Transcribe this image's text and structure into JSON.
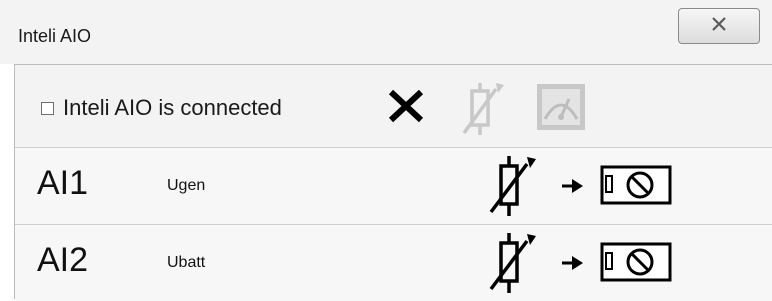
{
  "window": {
    "title": "Inteli AIO"
  },
  "toprow": {
    "checkbox_label": "Inteli AIO is connected",
    "checkbox_checked": false
  },
  "inputs": [
    {
      "name": "AI1",
      "signal": "Ugen"
    },
    {
      "name": "AI2",
      "signal": "Ubatt"
    }
  ],
  "icons": {
    "close": "close-icon",
    "status": "x-mark-icon",
    "sensor_disabled": "resistor-sensor-icon",
    "graph_disabled": "gauge-graph-icon",
    "sensor": "resistor-sensor-icon",
    "arrow": "arrow-right-icon",
    "terminal": "terminal-connector-icon"
  },
  "colors": {
    "titlebar": "#f3f3f3",
    "row_bg": "#f7f7f7",
    "disabled_icon": "#c8c8c8"
  }
}
